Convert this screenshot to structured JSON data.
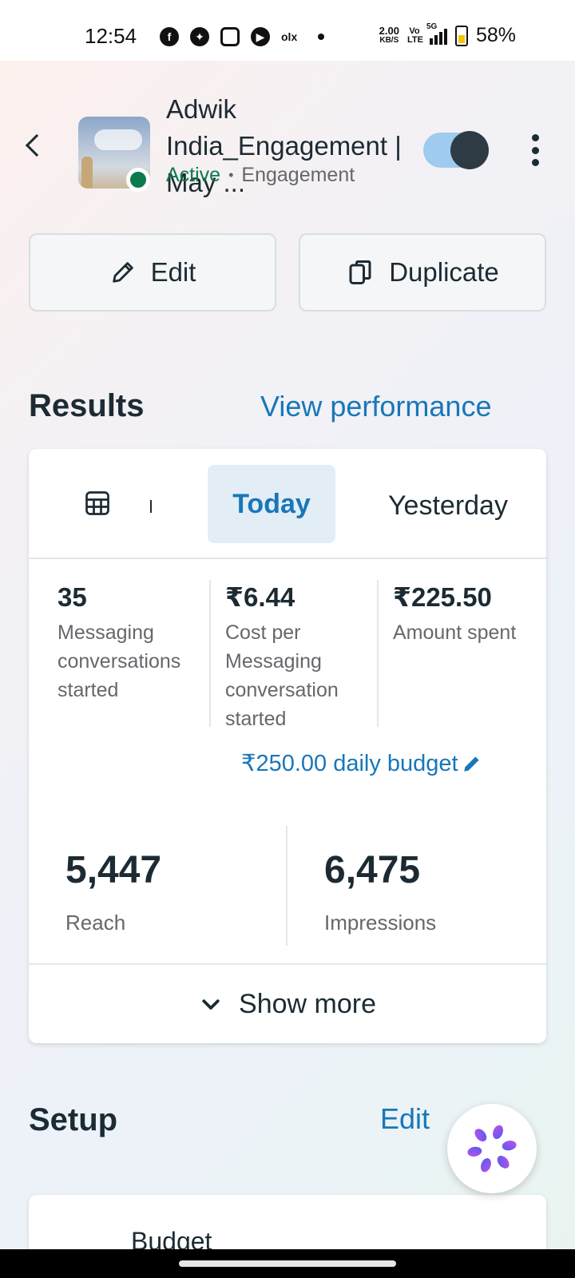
{
  "status_bar": {
    "time": "12:54",
    "net_speed": "2.00",
    "net_unit": "KB/S",
    "volte": "Vo LTE",
    "network": "5G",
    "battery": "58%"
  },
  "header": {
    "campaign_name": "Adwik India_Engagement | May ...",
    "status": "Active",
    "separator": "•",
    "objective": "Engagement",
    "toggle_on": true
  },
  "actions": {
    "edit_label": "Edit",
    "duplicate_label": "Duplicate"
  },
  "results": {
    "heading": "Results",
    "link": "View performance",
    "tabs": {
      "today": "Today",
      "yesterday": "Yesterday"
    },
    "metrics": [
      {
        "value": "35",
        "label": "Messaging conversations started"
      },
      {
        "value": "₹6.44",
        "label": "Cost per Messaging conversation started"
      },
      {
        "value": "₹225.50",
        "label": "Amount spent"
      }
    ],
    "budget_link": "₹250.00 daily budget",
    "reach": {
      "value": "5,447",
      "label": "Reach"
    },
    "impressions": {
      "value": "6,475",
      "label": "Impressions"
    },
    "show_more": "Show more"
  },
  "setup": {
    "heading": "Setup",
    "edit_link": "Edit",
    "budget_label": "Budget"
  },
  "colors": {
    "accent": "#1877b8",
    "active_green": "#0b7b4d",
    "text": "#1c2b33",
    "muted": "#65676b"
  }
}
